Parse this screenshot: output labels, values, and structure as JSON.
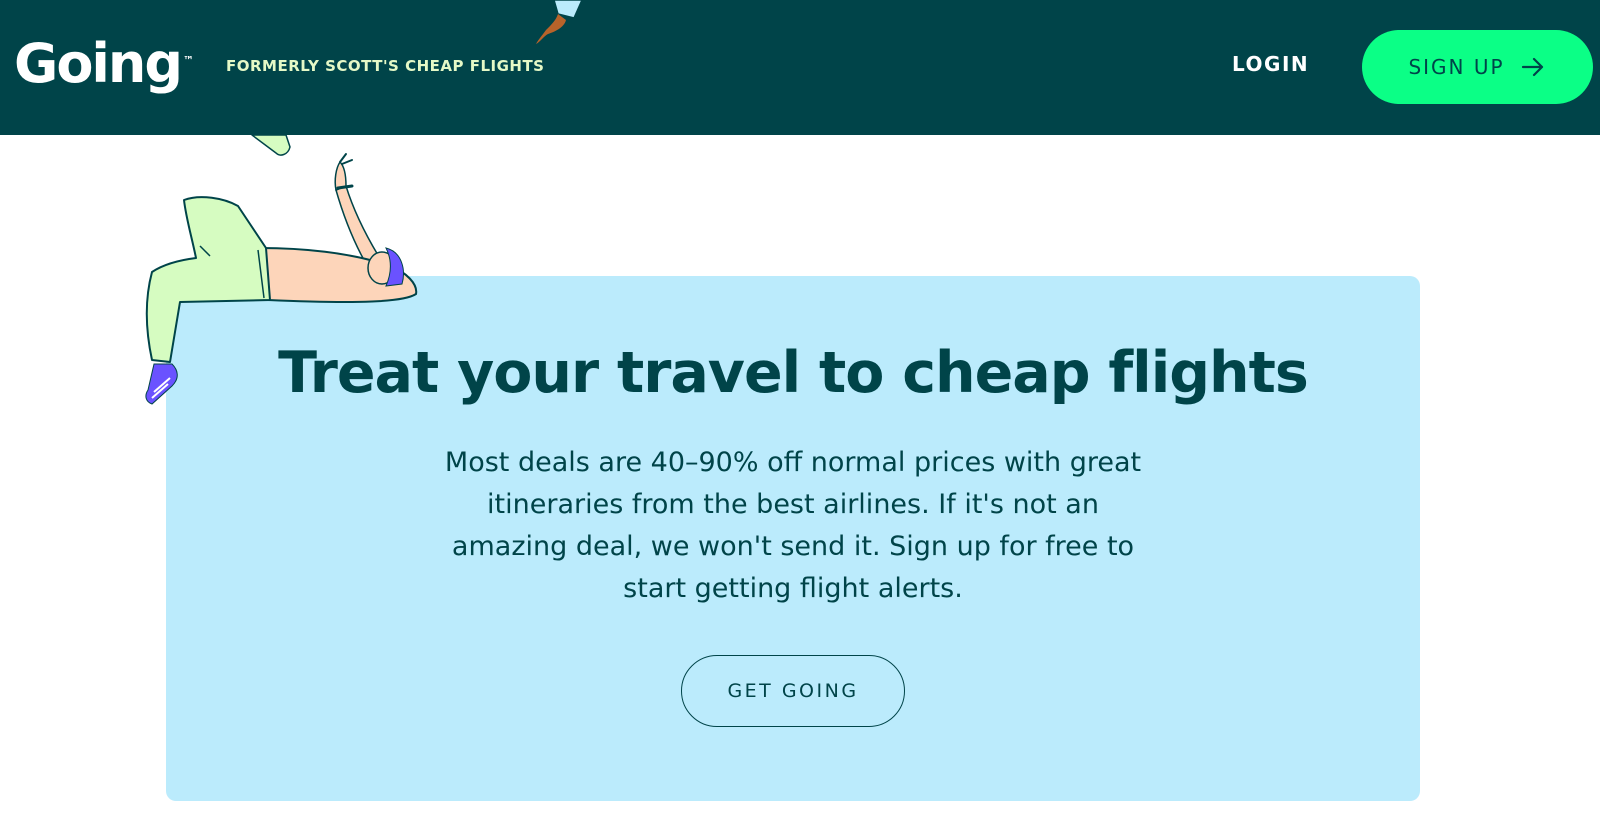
{
  "header": {
    "logo_text": "Going",
    "logo_tm": "™",
    "tagline": "FORMERLY SCOTT'S CHEAP FLIGHTS",
    "login_label": "LOGIN",
    "signup_label": "SIGN UP",
    "signup_icon": "arrow-right-icon"
  },
  "hero": {
    "headline": "Treat your travel to cheap flights",
    "body": "Most deals are 40–90% off normal prices with great itineraries from the best airlines. If it's not an amazing deal, we won't send it. Sign up for free to start getting flight alerts.",
    "cta_label": "GET GOING",
    "illustration": "person-reclining-illustration"
  },
  "colors": {
    "header_bg": "#004449",
    "tagline": "#e5f9c7",
    "signup_bg": "#0bff86",
    "card_bg": "#bbebfc",
    "text_dark": "#004449"
  }
}
